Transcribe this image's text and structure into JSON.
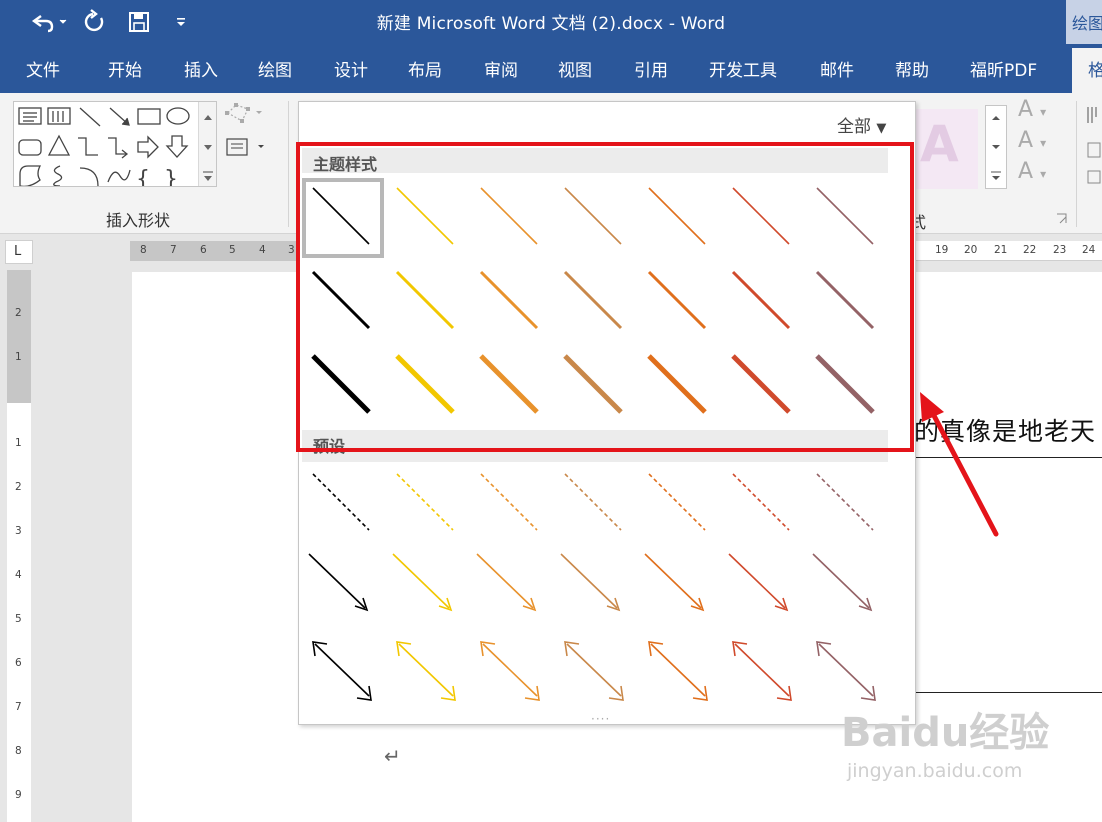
{
  "window": {
    "title": "新建 Microsoft Word 文档 (2).docx - Word",
    "context_tab_label": "绘图"
  },
  "quick_access": {
    "undo_icon": "undo-icon",
    "redo_icon": "redo-icon",
    "save_icon": "save-icon",
    "customize_icon": "chevron-down-icon"
  },
  "ribbon_tabs": [
    {
      "label": "文件"
    },
    {
      "label": "开始"
    },
    {
      "label": "插入"
    },
    {
      "label": "绘图"
    },
    {
      "label": "设计"
    },
    {
      "label": "布局"
    },
    {
      "label": "审阅"
    },
    {
      "label": "视图"
    },
    {
      "label": "引用"
    },
    {
      "label": "开发工具"
    },
    {
      "label": "邮件"
    },
    {
      "label": "帮助"
    },
    {
      "label": "福昕PDF"
    }
  ],
  "active_tab": {
    "label": "格"
  },
  "ribbon": {
    "insert_shapes_label": "插入形状",
    "styles_label_partial": "式",
    "wordart_letter": "A"
  },
  "shape_style_gallery": {
    "filter_label": "全部",
    "theme_section_title": "主题样式",
    "preset_section_title": "预设",
    "colors": [
      "#000000",
      "#f2c700",
      "#e8922c",
      "#c9884a",
      "#e06f1c",
      "#d04a2c",
      "#946266"
    ]
  },
  "rulers": {
    "horizontal_left": [
      "8",
      "7",
      "6",
      "5",
      "4",
      "3"
    ],
    "horizontal_right": [
      "19",
      "20",
      "21",
      "22",
      "23",
      "24"
    ],
    "vertical_gray": [
      "2",
      "1"
    ],
    "vertical_white": [
      "1",
      "2",
      "3",
      "4",
      "5",
      "6",
      "7",
      "8",
      "9"
    ],
    "corner_glyph": "L"
  },
  "document": {
    "visible_text": "的真像是地老天",
    "paragraph_mark": "↵"
  },
  "watermark": {
    "logo_text": "Baidu经验",
    "url": "jingyan.baidu.com"
  }
}
